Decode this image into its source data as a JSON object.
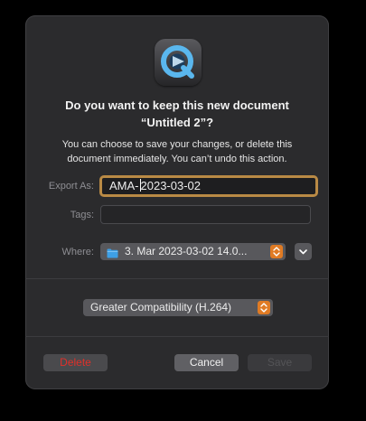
{
  "dialog": {
    "app_icon": "quicktime-icon",
    "title_line1": "Do you want to keep this new document",
    "title_line2": "“Untitled 2”?",
    "message_line1": "You can choose to save your changes, or delete this",
    "message_line2": "document immediately. You can’t undo this action."
  },
  "fields": {
    "export_as_label": "Export As:",
    "export_as_value_before_caret": "AMA-",
    "export_as_value_after_caret": "2023-03-02",
    "tags_label": "Tags:",
    "tags_value": "",
    "where_label": "Where:",
    "where_folder_icon": "folder-icon",
    "where_value": "3. Mar 2023-03-02 14.0..."
  },
  "format": {
    "selected": "Greater Compatibility (H.264)"
  },
  "buttons": {
    "delete": "Delete",
    "cancel": "Cancel",
    "save": "Save"
  },
  "colors": {
    "dialog_background": "#2b2b2d",
    "focus_ring": "#b98a45",
    "accent_stepper": "#e07b24",
    "destructive": "#e0302a",
    "folder_blue": "#3ea0e6"
  }
}
